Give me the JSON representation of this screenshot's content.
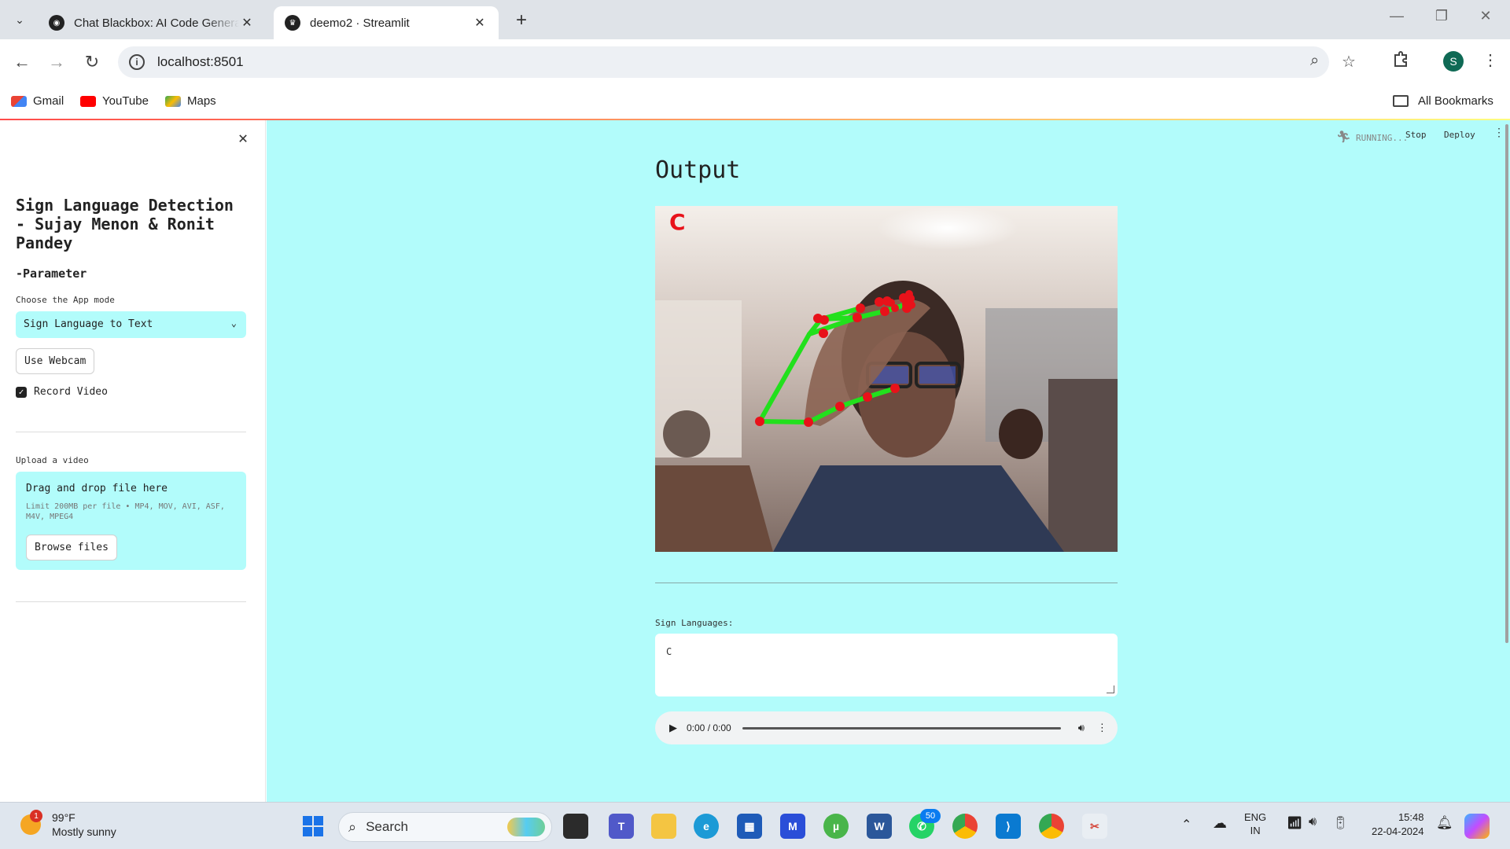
{
  "browser": {
    "tabs": [
      {
        "title": "Chat Blackbox: AI Code Genera",
        "active": false
      },
      {
        "title": "deemo2 · Streamlit",
        "active": true
      }
    ],
    "url": "localhost:8501",
    "profile_initial": "S",
    "bookmarks": [
      "Gmail",
      "YouTube",
      "Maps"
    ],
    "all_bookmarks": "All Bookmarks"
  },
  "sidebar": {
    "title": "Sign Language Detection - Sujay Menon & Ronit Pandey",
    "parameter": "-Parameter",
    "app_mode_label": "Choose the App mode",
    "app_mode_value": "Sign Language to Text",
    "webcam_button": "Use Webcam",
    "record_label": "Record Video",
    "record_checked": true,
    "upload_label": "Upload a video",
    "upload_drag": "Drag and drop file here",
    "upload_limit": "Limit 200MB per file • MP4, MOV, AVI, ASF, M4V, MPEG4",
    "browse_button": "Browse files"
  },
  "header": {
    "running": "RUNNING...",
    "stop": "Stop",
    "deploy": "Deploy"
  },
  "main": {
    "title": "Output",
    "detected_letter": "C",
    "sign_languages_label": "Sign Languages:",
    "sign_languages_value": "C",
    "audio_time": "0:00 / 0:00"
  },
  "taskbar": {
    "weather_temp": "99°F",
    "weather_desc": "Mostly sunny",
    "weather_badge": "1",
    "search": "Search",
    "whatsapp_badge": "50",
    "lang1": "ENG",
    "lang2": "IN",
    "time": "15:48",
    "date": "22-04-2024"
  },
  "colors": {
    "streamlit_bg": "#b2fcfb",
    "landmark": "#e8121a",
    "connector": "#22e01d"
  }
}
